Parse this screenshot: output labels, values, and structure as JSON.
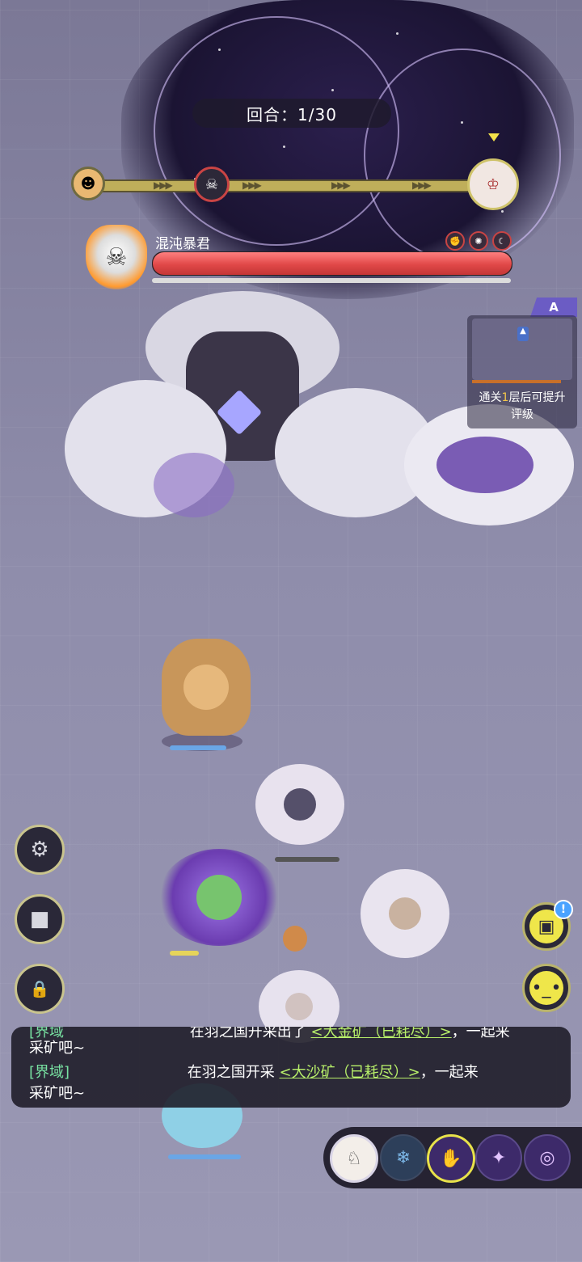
{
  "hud": {
    "round_label": "回合：1/30",
    "turn_order": [
      {
        "name": "scarecrow",
        "icon": "☻"
      },
      {
        "name": "chaos-tyrant",
        "icon": "☠"
      },
      {
        "name": "sheep-hero",
        "icon": "♔"
      }
    ]
  },
  "boss": {
    "name": "混沌暴君",
    "hp_percent": 100,
    "status_icons": [
      "fist-icon",
      "burst-icon",
      "moon-icon"
    ]
  },
  "rank": {
    "grade": "A",
    "hint_prefix": "通关",
    "hint_highlight": "1",
    "hint_suffix": "层后可提升",
    "hint_line2": "评级"
  },
  "side_buttons": {
    "settings": "⚙",
    "replay": "■",
    "lock": "🔒"
  },
  "right_buttons": {
    "chest_badge": "!",
    "emote": "😐"
  },
  "chat": {
    "line1_tag": "[界域",
    "line1_text": "在羽之国开采出了",
    "line1_ore": "<大金矿（已耗尽）>",
    "line1_tail": "，一起来",
    "line1_cont": "采矿吧~",
    "line2_tag": "[界域]",
    "line2_text": "在羽之国开采",
    "line2_ore": "<大沙矿（已耗尽）>",
    "line2_tail": "，一起来",
    "line2_cont": "采矿吧~"
  },
  "skills": [
    {
      "name": "hero-portrait",
      "icon": "♘"
    },
    {
      "name": "ice-shard",
      "icon": "❄"
    },
    {
      "name": "void-hand",
      "icon": "✋"
    },
    {
      "name": "dark-slash",
      "icon": "✦"
    },
    {
      "name": "vortex",
      "icon": "◎"
    }
  ],
  "colors": {
    "hp_red": "#e04848",
    "accent_yellow": "#efe64a",
    "chat_green": "#78e2a2",
    "ore_green": "#b8f06a",
    "rank_purple": "#6b5cc4"
  }
}
